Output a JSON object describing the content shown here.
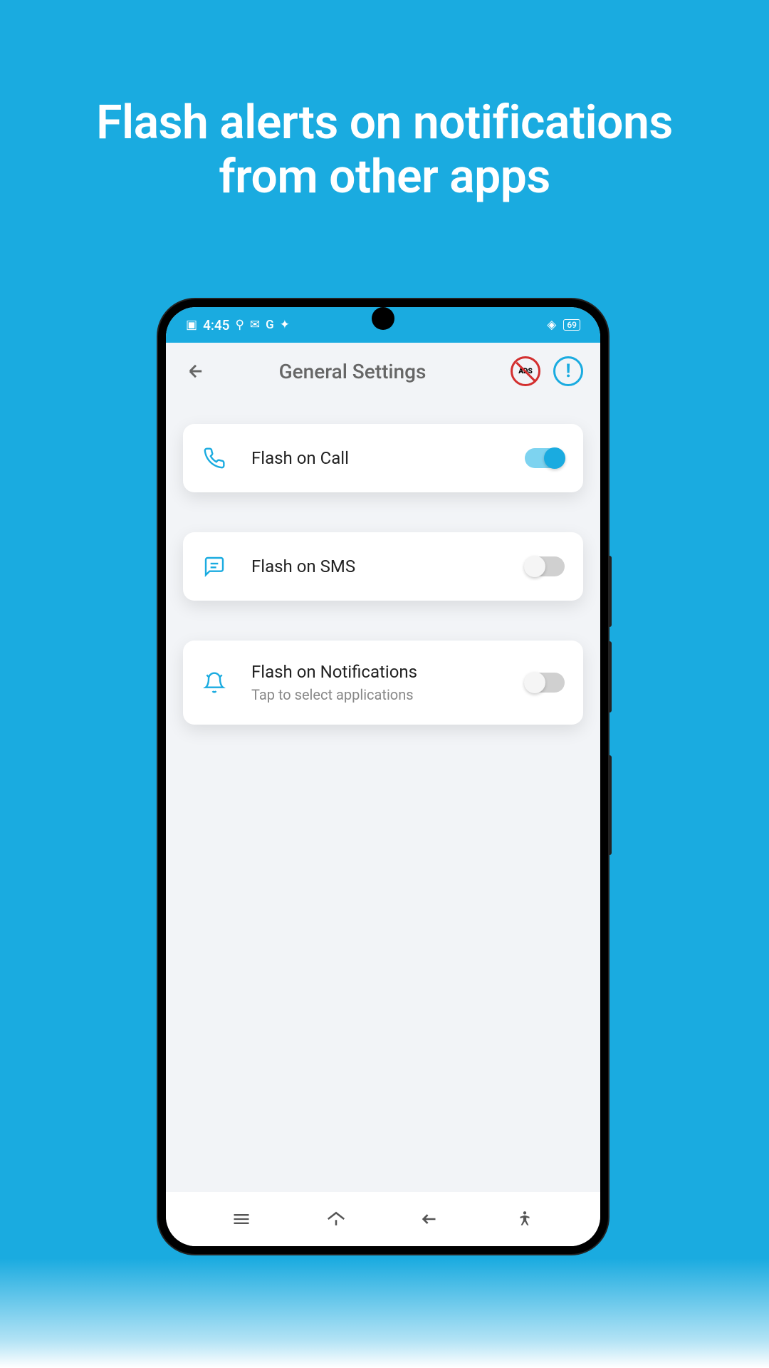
{
  "promo": {
    "title_line1": "Flash alerts on notifications",
    "title_line2": "from other apps"
  },
  "status_bar": {
    "time": "4:45",
    "battery_level": "69"
  },
  "header": {
    "title": "General Settings",
    "no_ads_label": "ADS"
  },
  "settings": [
    {
      "icon": "phone",
      "title": "Flash on Call",
      "subtitle": "",
      "enabled": true
    },
    {
      "icon": "sms",
      "title": "Flash on SMS",
      "subtitle": "",
      "enabled": false
    },
    {
      "icon": "bell",
      "title": "Flash on Notifications",
      "subtitle": "Tap to select applications",
      "enabled": false
    }
  ]
}
